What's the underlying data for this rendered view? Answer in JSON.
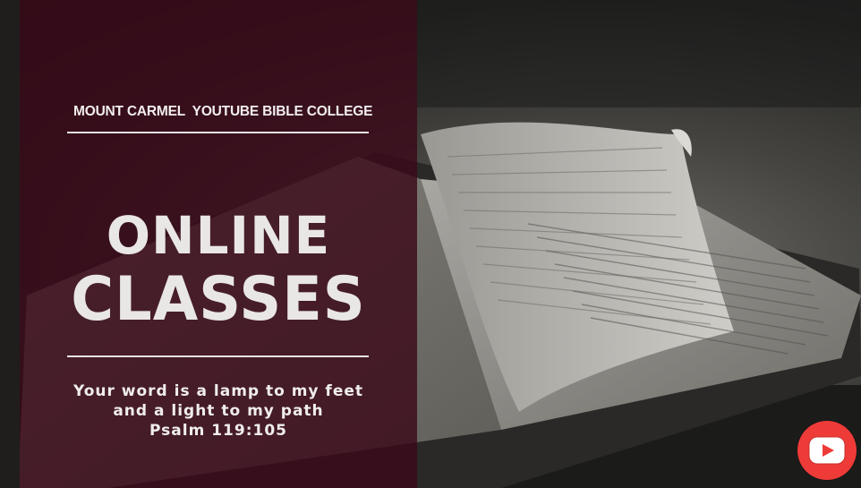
{
  "header": {
    "college_name": "MOUNT CARMEL  YOUTUBE BIBLE COLLEGE"
  },
  "headline": {
    "line1": "ONLINE",
    "line2": "CLASSES"
  },
  "verse": {
    "line1": "Your word is a lamp to my feet",
    "line2": "and a light to my path",
    "reference": "Psalm 119:105"
  },
  "icons": {
    "play_button": "youtube-play-icon"
  },
  "colors": {
    "panel": "#3a0a1a",
    "text": "#f0eded",
    "youtube_red": "#ee3b38"
  }
}
